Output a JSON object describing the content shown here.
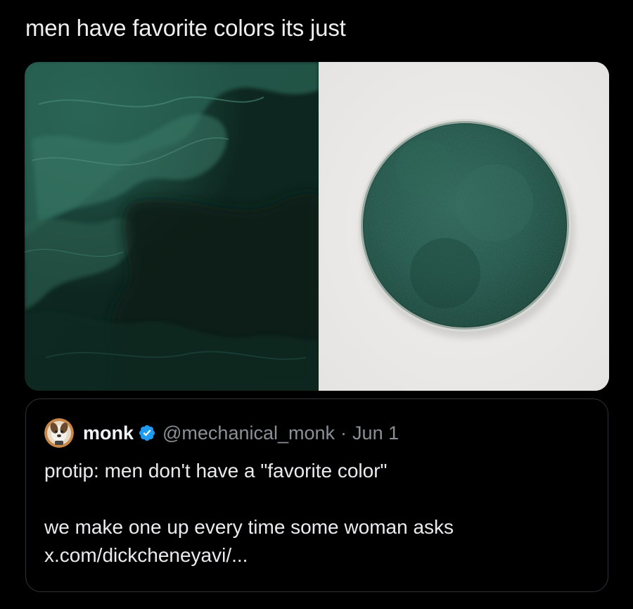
{
  "post": {
    "text": "men have favorite colors its just"
  },
  "media": {
    "left_image_alt": "dark green marbled texture",
    "right_image_alt": "dish of green pigment powder"
  },
  "quoted_post": {
    "display_name": "monk",
    "verified_icon": "verified-badge-icon",
    "handle": "@mechanical_monk",
    "separator": "·",
    "date": "Jun 1",
    "line1": "protip: men don't have a \"favorite color\"",
    "line2": "we make one up every time some woman asks",
    "link": "x.com/dickcheneyavi/..."
  },
  "colors": {
    "background": "#000000",
    "text": "#e7e9ea",
    "secondary_text": "#8b9096",
    "border": "#2f3336",
    "verified_blue": "#1d9bf0",
    "green_dark": "#0e2c23",
    "green_pigment": "#1d4f42"
  }
}
